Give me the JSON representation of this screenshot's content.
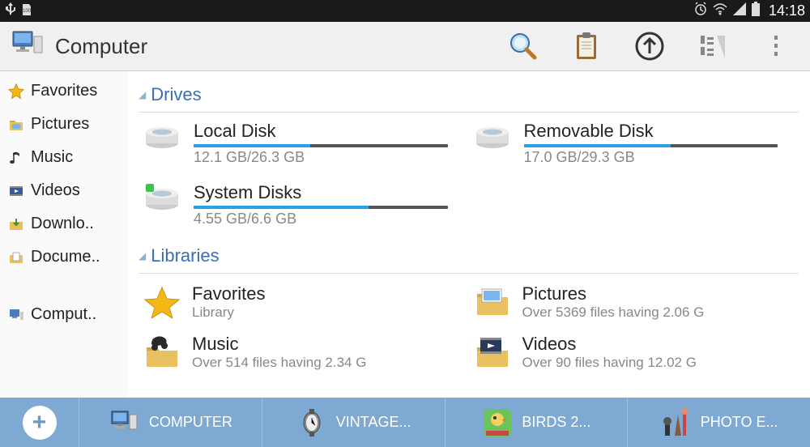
{
  "statusbar": {
    "clock": "14:18"
  },
  "toolbar": {
    "title": "Computer"
  },
  "sidebar": {
    "items": [
      {
        "label": "Favorites"
      },
      {
        "label": "Pictures"
      },
      {
        "label": "Music"
      },
      {
        "label": "Videos"
      },
      {
        "label": "Downlo.."
      },
      {
        "label": "Docume.."
      }
    ],
    "footer": {
      "label": "Comput.."
    }
  },
  "sections": {
    "drives": {
      "title": "Drives",
      "items": [
        {
          "name": "Local Disk",
          "sub": "12.1 GB/26.3 GB",
          "pct": 46
        },
        {
          "name": "Removable Disk",
          "sub": "17.0 GB/29.3 GB",
          "pct": 58
        },
        {
          "name": "System Disks",
          "sub": "4.55 GB/6.6 GB",
          "pct": 69
        }
      ]
    },
    "libraries": {
      "title": "Libraries",
      "items": [
        {
          "name": "Favorites",
          "sub": "Library"
        },
        {
          "name": "Pictures",
          "sub": "Over 5369 files having 2.06 G"
        },
        {
          "name": "Music",
          "sub": "Over 514 files having 2.34 G"
        },
        {
          "name": "Videos",
          "sub": "Over 90 files having 12.02 G"
        }
      ]
    }
  },
  "tabs": [
    {
      "label": "COMPUTER"
    },
    {
      "label": "VINTAGE..."
    },
    {
      "label": "BIRDS 2..."
    },
    {
      "label": "PHOTO E..."
    }
  ]
}
